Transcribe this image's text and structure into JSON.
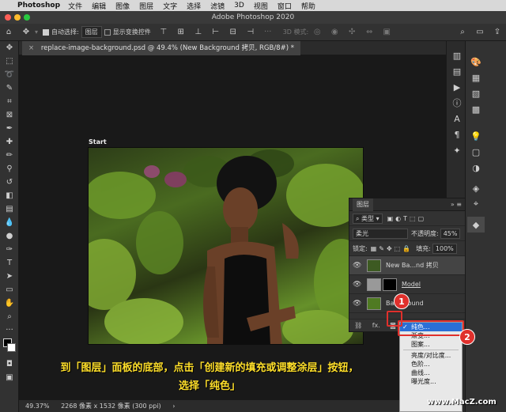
{
  "menubar": {
    "app": "Photoshop",
    "items": [
      "文件",
      "编辑",
      "图像",
      "图层",
      "文字",
      "选择",
      "滤镜",
      "3D",
      "视图",
      "窗口",
      "帮助"
    ]
  },
  "window": {
    "title": "Adobe Photoshop 2020"
  },
  "options": {
    "auto_select_label": "自动选择:",
    "auto_select_value": "图层",
    "transform_label": "显示变换控件",
    "mode3d": "3D 模式:"
  },
  "document": {
    "tab": "replace-image-background.psd @ 49.4% (New Background 拷贝, RGB/8#) *",
    "start_label": "Start",
    "zoom": "49.37%",
    "size_info": "2268 像素 x 1532 像素 (300 ppi)"
  },
  "layers_panel": {
    "title": "图层",
    "filter_kind": "类型",
    "blend_mode": "柔光",
    "opacity_label": "不透明度:",
    "opacity_value": "45%",
    "lock_label": "锁定:",
    "fill_label": "填充:",
    "fill_value": "100%",
    "layers": [
      {
        "name": "New Ba...nd 拷贝"
      },
      {
        "name": "Model"
      },
      {
        "name": "Background"
      }
    ],
    "footer_fx": "fx."
  },
  "dropdown": {
    "items": [
      "纯色...",
      "渐变...",
      "图案...",
      "亮度/对比度...",
      "色阶...",
      "曲线...",
      "曝光度..."
    ]
  },
  "badges": [
    "1",
    "2"
  ],
  "caption": {
    "line1": "到「图层」面板的底部，点击「创建新的填充或调整涂层」按钮，",
    "line2": "选择「纯色」"
  },
  "watermark": "www.MacZ.com",
  "colors": {
    "accent": "#2a6fd6",
    "callout": "#e0302c",
    "caption": "#ffdf2a"
  }
}
